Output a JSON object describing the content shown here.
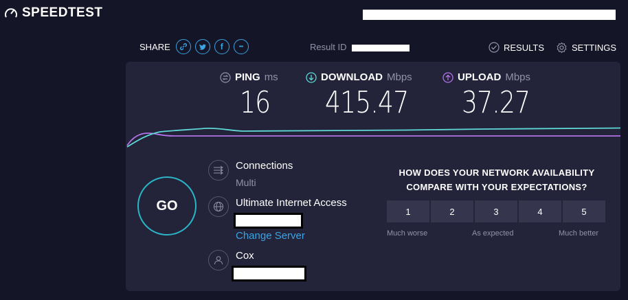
{
  "header": {
    "logo_text": "SPEEDTEST",
    "logo_icon": "gauge-icon"
  },
  "share": {
    "label": "SHARE",
    "buttons": [
      {
        "icon": "link-icon"
      },
      {
        "icon": "twitter-icon"
      },
      {
        "icon": "facebook-icon",
        "glyph": "f"
      },
      {
        "icon": "more-icon",
        "glyph": "•••"
      }
    ]
  },
  "result": {
    "label": "Result ID"
  },
  "nav": {
    "results_label": "RESULTS",
    "settings_label": "SETTINGS"
  },
  "metrics": {
    "ping": {
      "label": "PING",
      "unit": "ms",
      "value": "16",
      "icon": "ping-icon"
    },
    "download": {
      "label": "DOWNLOAD",
      "unit": "Mbps",
      "value": "415.47",
      "icon": "download-icon",
      "color": "#5fd9d6"
    },
    "upload": {
      "label": "UPLOAD",
      "unit": "Mbps",
      "value": "37.27",
      "icon": "upload-icon",
      "color": "#b373e8"
    }
  },
  "go_label": "GO",
  "connections": {
    "title": "Connections",
    "value": "Multi",
    "icon": "connections-icon"
  },
  "server": {
    "name": "Ultimate Internet Access",
    "change_label": "Change Server",
    "icon": "globe-icon"
  },
  "provider": {
    "name": "Cox",
    "icon": "user-icon"
  },
  "survey": {
    "question_line1": "HOW DOES YOUR NETWORK AVAILABILITY",
    "question_line2": "COMPARE WITH YOUR EXPECTATIONS?",
    "ratings": [
      "1",
      "2",
      "3",
      "4",
      "5"
    ],
    "scale_low": "Much worse",
    "scale_mid": "As expected",
    "scale_high": "Much better"
  },
  "colors": {
    "accent": "#3aa4e6",
    "go_ring": "#2bb6c8",
    "download_line": "#5fd9d6",
    "upload_line": "#b373e8"
  }
}
